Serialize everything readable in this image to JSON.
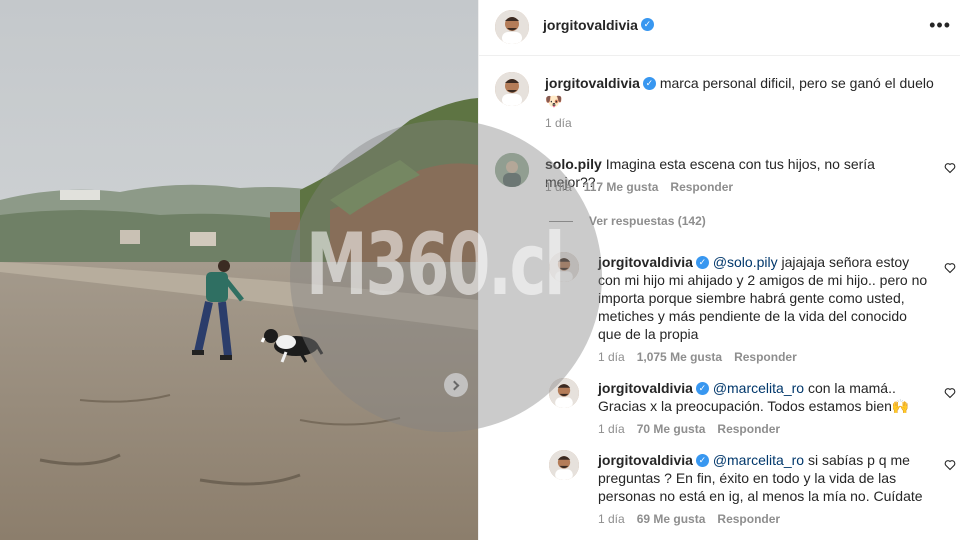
{
  "post": {
    "username": "jorgitovaldivia",
    "more_icon": "more-horizontal-icon"
  },
  "caption": {
    "username": "jorgitovaldivia",
    "text": "marca personal dificil, pero se ganó el duelo",
    "emoji": "🐶",
    "time": "1 día"
  },
  "comments": [
    {
      "username": "solo.pily",
      "text": "Imagina esta escena con tus hijos, no sería mejor??",
      "time": "1 día",
      "likes": "117 Me gusta",
      "reply": "Responder"
    }
  ],
  "view_replies": "Ver respuestas (142)",
  "replies": [
    {
      "username": "jorgitovaldivia",
      "mention": "@solo.pily",
      "text": "jajajaja señora estoy con mi hijo mi ahijado y 2 amigos de mi hijo.. pero no importa porque siembre habrá gente como usted, metiches y más pendiente de la vida del conocido que de la propia",
      "time": "1 día",
      "likes": "1,075 Me gusta",
      "reply": "Responder"
    },
    {
      "username": "jorgitovaldivia",
      "mention": "@marcelita_ro",
      "text": "con la mamá.. Gracias x la preocupación. Todos estamos bien🙌",
      "time": "1 día",
      "likes": "70 Me gusta",
      "reply": "Responder"
    },
    {
      "username": "jorgitovaldivia",
      "mention": "@marcelita_ro",
      "text": "si sabías p q me preguntas ? En fin, éxito en todo y la vida de las personas no está en ig, al menos la mía no. Cuídate",
      "time": "1 día",
      "likes": "69 Me gusta",
      "reply": "Responder"
    }
  ],
  "watermark": "M360.cl",
  "colors": {
    "verified": "#3897f0",
    "mention": "#00376b",
    "meta": "#8e8e8e"
  }
}
